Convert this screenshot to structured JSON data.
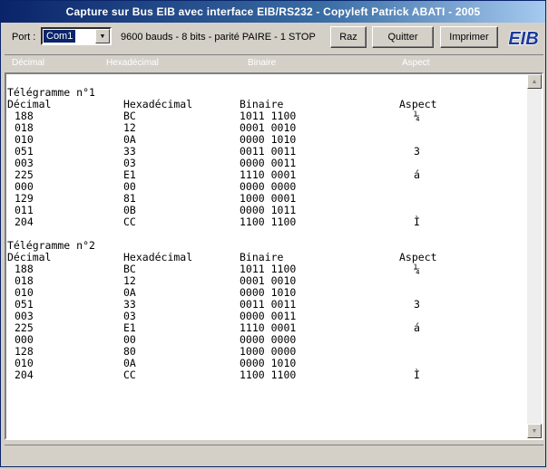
{
  "window": {
    "title": "Capture sur Bus EIB avec interface EIB/RS232  -  Copyleft Patrick ABATI  -  2005"
  },
  "toolbar": {
    "port_label": "Port :",
    "port_value": "Com1",
    "params": "9600 bauds - 8 bits - parité PAIRE - 1 STOP",
    "raz_label": "Raz",
    "quit_label": "Quitter",
    "print_label": "Imprimer",
    "logo_text": "EIB"
  },
  "columns": [
    "Décimal",
    "Hexadécimal",
    "Binaire",
    "Aspect"
  ],
  "telegrams": [
    {
      "title": "Télégramme n°1",
      "rows": [
        [
          "188",
          "BC",
          "1011 1100",
          "¼"
        ],
        [
          "018",
          "12",
          "0001 0010",
          ""
        ],
        [
          "010",
          "0A",
          "0000 1010",
          ""
        ],
        [
          "051",
          "33",
          "0011 0011",
          "3"
        ],
        [
          "003",
          "03",
          "0000 0011",
          ""
        ],
        [
          "225",
          "E1",
          "1110 0001",
          "á"
        ],
        [
          "000",
          "00",
          "0000 0000",
          ""
        ],
        [
          "129",
          "81",
          "1000 0001",
          ""
        ],
        [
          "011",
          "0B",
          "0000 1011",
          ""
        ],
        [
          "204",
          "CC",
          "1100 1100",
          "Ì"
        ]
      ]
    },
    {
      "title": "Télégramme n°2",
      "rows": [
        [
          "188",
          "BC",
          "1011 1100",
          "¼"
        ],
        [
          "018",
          "12",
          "0001 0010",
          ""
        ],
        [
          "010",
          "0A",
          "0000 1010",
          ""
        ],
        [
          "051",
          "33",
          "0011 0011",
          "3"
        ],
        [
          "003",
          "03",
          "0000 0011",
          ""
        ],
        [
          "225",
          "E1",
          "1110 0001",
          "á"
        ],
        [
          "000",
          "00",
          "0000 0000",
          ""
        ],
        [
          "128",
          "80",
          "1000 0000",
          ""
        ],
        [
          "010",
          "0A",
          "0000 1010",
          ""
        ],
        [
          "204",
          "CC",
          "1100 1100",
          "Ì"
        ]
      ]
    }
  ],
  "icons": {
    "dropdown": "chevron-down-icon",
    "scroll_up": "arrow-up-icon",
    "scroll_down": "arrow-down-icon"
  },
  "colors": {
    "title_bar": "#0a246a",
    "selection": "#0a246a",
    "face": "#d4d0c8",
    "logo": "#1a3a9a"
  }
}
